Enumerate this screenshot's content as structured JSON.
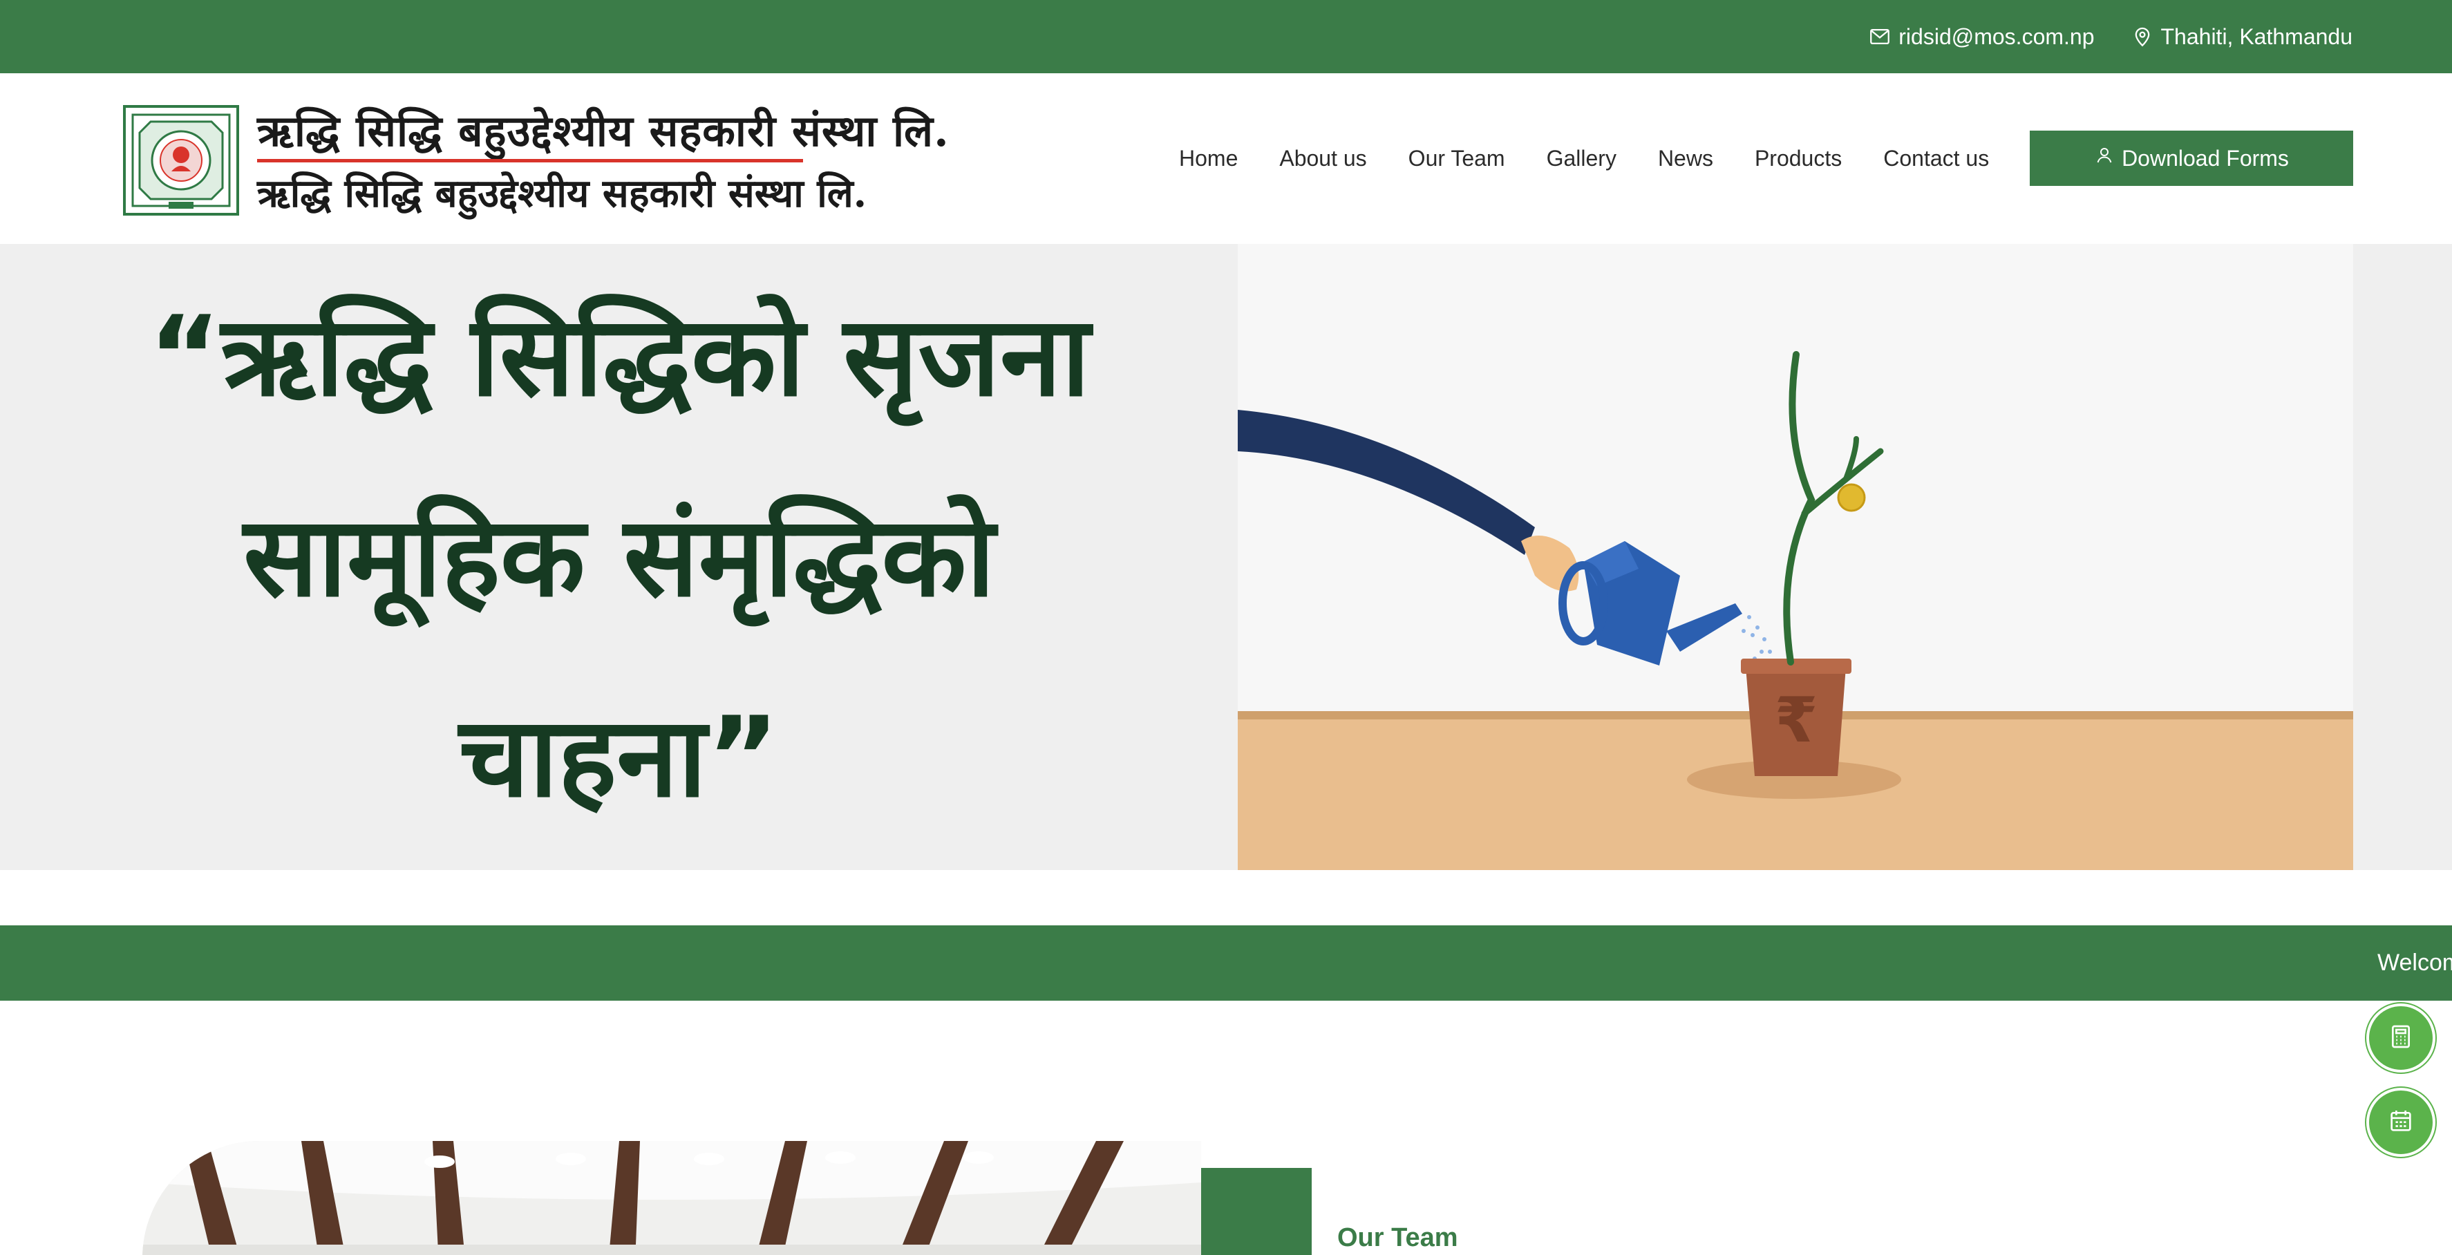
{
  "topbar": {
    "email": "ridsid@mos.com.np",
    "location": "Thahiti, Kathmandu",
    "email_icon": "envelope-icon",
    "location_icon": "map-pin-icon"
  },
  "brand": {
    "name_script": "ऋद्धि सिद्धि बहुउद्देश्यीय सहकारी संस्था लि.",
    "name_devanagari": "ऋद्धि सिद्धि बहुउद्देश्यीय सहकारी संस्था लि.",
    "seal_icon": "ganesh-seal-logo"
  },
  "nav": {
    "items": [
      "Home",
      "About us",
      "Our Team",
      "Gallery",
      "News",
      "Products",
      "Contact us"
    ],
    "download_label": "Download Forms",
    "download_icon": "user-icon"
  },
  "hero": {
    "quote": "“ऋद्धि सिद्धिको सृजना सामूहिक संमृद्धिको चाहना”",
    "illustration": "hand-watering-money-plant",
    "currency_symbol": "₹"
  },
  "marquee": {
    "text": "Welcom"
  },
  "floating": {
    "calculator_icon": "calculator-icon",
    "calendar_icon": "calendar-icon"
  },
  "team": {
    "title": "Our Team"
  },
  "colors": {
    "brand_green": "#3b7c48",
    "hero_text": "#163a22",
    "fab_green": "#5bb34b",
    "hero_bg": "#efefef"
  }
}
